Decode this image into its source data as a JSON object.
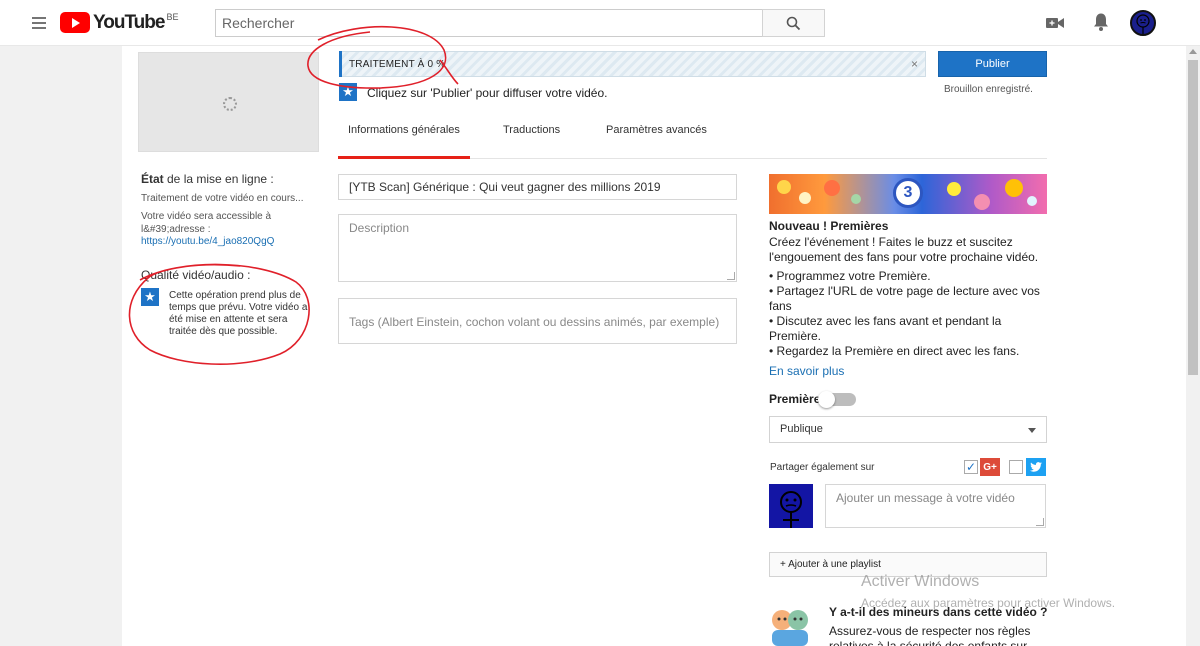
{
  "header": {
    "logo_text": "YouTube",
    "logo_region": "BE",
    "search_placeholder": "Rechercher",
    "icons": [
      "menu-icon",
      "search-icon",
      "video-camera-icon",
      "bell-icon",
      "avatar"
    ]
  },
  "left": {
    "state_title_bold": "État",
    "state_title_rest": " de la mise en ligne :",
    "state_processing": "Traitement de votre vidéo en cours...",
    "state_access": "Votre vidéo sera accessible à l&#39;adresse :",
    "state_link": "https://youtu.be/4_jao820QgQ",
    "quality_title": "Qualité vidéo/audio :",
    "quality_text": "Cette opération prend plus de temps que prévu. Votre vidéo a été mise en attente et sera traitée dès que possible."
  },
  "progress": {
    "label": "TRAITEMENT À 0 %",
    "close": "×"
  },
  "publish": {
    "button_label": "Publier",
    "draft_note": "Brouillon enregistré.",
    "hint": "Cliquez sur 'Publier' pour diffuser votre vidéo."
  },
  "tabs": [
    {
      "label": "Informations générales",
      "active": true
    },
    {
      "label": "Traductions",
      "active": false
    },
    {
      "label": "Paramètres avancés",
      "active": false
    }
  ],
  "form": {
    "title_value": "[YTB Scan] Générique : Qui veut gagner des millions 2019",
    "description_placeholder": "Description",
    "tags_placeholder": "Tags (Albert Einstein, cochon volant ou dessins animés, par exemple)"
  },
  "premiere": {
    "banner_number": "3",
    "title": "Nouveau ! Premières",
    "description": "Créez l'événement ! Faites le buzz et suscitez l'engouement des fans pour votre prochaine vidéo.",
    "bullets": [
      "• Programmez votre Première.",
      "• Partagez l'URL de votre page de lecture avec vos fans",
      "• Discutez avec les fans avant et pendant la Première.",
      "• Regardez la Première en direct avec les fans."
    ],
    "learn_more": "En savoir plus",
    "toggle_label": "Première",
    "toggle_on": false
  },
  "visibility": {
    "selected": "Publique"
  },
  "share": {
    "label": "Partager également sur",
    "gplus_checked": true,
    "twitter_checked": false,
    "gplus_text": "G+",
    "message_placeholder": "Ajouter un message à votre vidéo"
  },
  "playlist": {
    "button_label": "+ Ajouter à une playlist"
  },
  "minors": {
    "title": "Y a-t-il des mineurs dans cette vidéo ?",
    "text": "Assurez-vous de respecter nos règles relatives à la sécurité des enfants sur"
  },
  "watermark": {
    "title": "Activer Windows",
    "text": "Accédez aux paramètres pour activer Windows."
  },
  "colors": {
    "brand_red": "#ff0000",
    "accent_blue": "#1e73c6",
    "tab_active": "#e62117",
    "annotation": "#e0202a"
  }
}
